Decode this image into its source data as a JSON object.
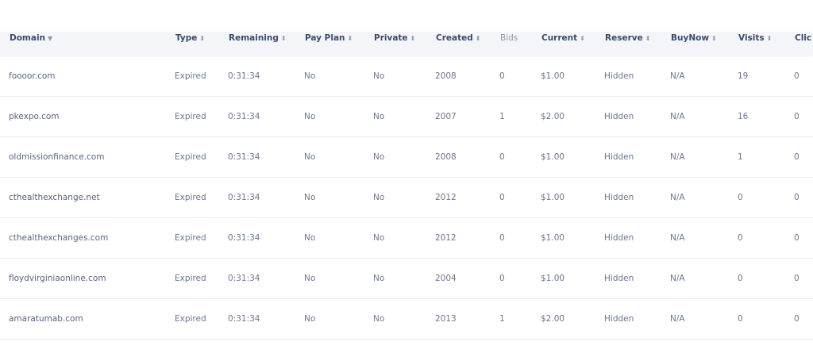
{
  "table": {
    "columns": [
      {
        "key": "domain",
        "label": "Domain",
        "sort": "▼",
        "plain": false
      },
      {
        "key": "type",
        "label": "Type",
        "sort": "⬍",
        "plain": false
      },
      {
        "key": "remaining",
        "label": "Remaining",
        "sort": "⬍",
        "plain": false
      },
      {
        "key": "payplan",
        "label": "Pay Plan",
        "sort": "⬍",
        "plain": false
      },
      {
        "key": "private",
        "label": "Private",
        "sort": "⬍",
        "plain": false
      },
      {
        "key": "created",
        "label": "Created",
        "sort": "⬍",
        "plain": false
      },
      {
        "key": "bids",
        "label": "Bids",
        "sort": "",
        "plain": true
      },
      {
        "key": "current",
        "label": "Current",
        "sort": "⬍",
        "plain": false
      },
      {
        "key": "reserve",
        "label": "Reserve",
        "sort": "⬍",
        "plain": false
      },
      {
        "key": "buynow",
        "label": "BuyNow",
        "sort": "⬍",
        "plain": false
      },
      {
        "key": "visits",
        "label": "Visits",
        "sort": "⬍",
        "plain": false
      },
      {
        "key": "clicks",
        "label": "Clic",
        "sort": "",
        "plain": false
      }
    ],
    "rows": [
      {
        "domain": "foooor.com",
        "type": "Expired",
        "remaining": "0:31:34",
        "payplan": "No",
        "private": "No",
        "created": "2008",
        "bids": "0",
        "current": "$1.00",
        "reserve": "Hidden",
        "buynow": "N/A",
        "visits": "19",
        "clicks": "0"
      },
      {
        "domain": "pkexpo.com",
        "type": "Expired",
        "remaining": "0:31:34",
        "payplan": "No",
        "private": "No",
        "created": "2007",
        "bids": "1",
        "current": "$2.00",
        "reserve": "Hidden",
        "buynow": "N/A",
        "visits": "16",
        "clicks": "0"
      },
      {
        "domain": "oldmissionfinance.com",
        "type": "Expired",
        "remaining": "0:31:34",
        "payplan": "No",
        "private": "No",
        "created": "2008",
        "bids": "0",
        "current": "$1.00",
        "reserve": "Hidden",
        "buynow": "N/A",
        "visits": "1",
        "clicks": "0"
      },
      {
        "domain": "cthealthexchange.net",
        "type": "Expired",
        "remaining": "0:31:34",
        "payplan": "No",
        "private": "No",
        "created": "2012",
        "bids": "0",
        "current": "$1.00",
        "reserve": "Hidden",
        "buynow": "N/A",
        "visits": "0",
        "clicks": "0"
      },
      {
        "domain": "cthealthexchanges.com",
        "type": "Expired",
        "remaining": "0:31:34",
        "payplan": "No",
        "private": "No",
        "created": "2012",
        "bids": "0",
        "current": "$1.00",
        "reserve": "Hidden",
        "buynow": "N/A",
        "visits": "0",
        "clicks": "0"
      },
      {
        "domain": "floydvirginiaonline.com",
        "type": "Expired",
        "remaining": "0:31:34",
        "payplan": "No",
        "private": "No",
        "created": "2004",
        "bids": "0",
        "current": "$1.00",
        "reserve": "Hidden",
        "buynow": "N/A",
        "visits": "0",
        "clicks": "0"
      },
      {
        "domain": "amaratumab.com",
        "type": "Expired",
        "remaining": "0:31:34",
        "payplan": "No",
        "private": "No",
        "created": "2013",
        "bids": "1",
        "current": "$2.00",
        "reserve": "Hidden",
        "buynow": "N/A",
        "visits": "0",
        "clicks": "0"
      }
    ]
  },
  "colors": {
    "header_bg": "#f3f5f8",
    "header_text": "#3b4a6b",
    "cell_text": "#6b7590",
    "divider": "#e9ecf1"
  }
}
